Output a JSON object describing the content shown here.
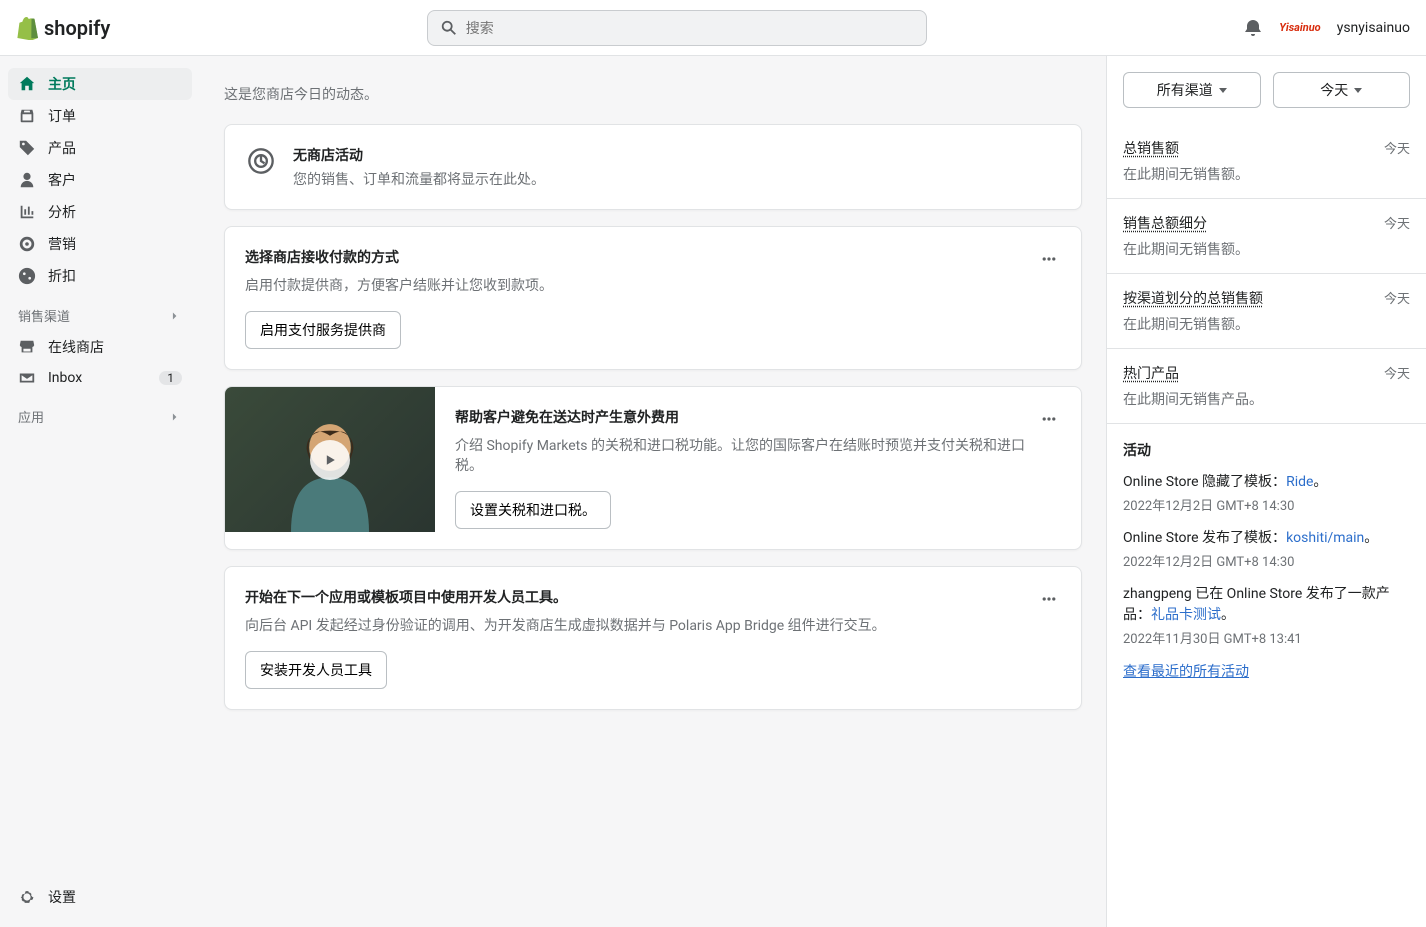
{
  "header": {
    "brand": "shopify",
    "search_placeholder": "搜索",
    "tag": "Yisainuo",
    "username": "ysnyisainuo"
  },
  "sidebar": {
    "items": [
      {
        "label": "主页",
        "icon": "home",
        "active": true
      },
      {
        "label": "订单",
        "icon": "orders"
      },
      {
        "label": "产品",
        "icon": "products"
      },
      {
        "label": "客户",
        "icon": "customers"
      },
      {
        "label": "分析",
        "icon": "analytics"
      },
      {
        "label": "营销",
        "icon": "marketing"
      },
      {
        "label": "折扣",
        "icon": "discounts"
      }
    ],
    "channels_label": "销售渠道",
    "channels": [
      {
        "label": "在线商店",
        "icon": "store"
      },
      {
        "label": "Inbox",
        "icon": "inbox",
        "badge": "1"
      }
    ],
    "apps_label": "应用",
    "settings_label": "设置"
  },
  "main": {
    "subtitle": "这是您商店今日的动态。",
    "feed": {
      "title": "无商店活动",
      "desc": "您的销售、订单和流量都将显示在此处。"
    },
    "cards": [
      {
        "title": "选择商店接收付款的方式",
        "desc": "启用付款提供商，方便客户结账并让您收到款项。",
        "button": "启用支付服务提供商"
      },
      {
        "media": true,
        "title": "帮助客户避免在送达时产生意外费用",
        "desc": "介绍 Shopify Markets 的关税和进口税功能。让您的国际客户在结账时预览并支付关税和进口税。",
        "button": "设置关税和进口税。"
      },
      {
        "title": "开始在下一个应用或模板项目中使用开发人员工具。",
        "desc": "向后台 API 发起经过身份验证的调用、为开发商店生成虚拟数据并与 Polaris App Bridge 组件进行交互。",
        "button": "安装开发人员工具"
      }
    ]
  },
  "panel": {
    "dropdown_channels": "所有渠道",
    "dropdown_today": "今天",
    "metrics": [
      {
        "label": "总销售额",
        "time": "今天",
        "empty": "在此期间无销售额。"
      },
      {
        "label": "销售总额细分",
        "time": "今天",
        "empty": "在此期间无销售额。"
      },
      {
        "label": "按渠道划分的总销售额",
        "time": "今天",
        "empty": "在此期间无销售额。"
      },
      {
        "label": "热门产品",
        "time": "今天",
        "empty": "在此期间无销售产品。"
      }
    ],
    "activity_title": "活动",
    "activities": [
      {
        "prefix": "Online Store 隐藏了模板：",
        "link": "Ride",
        "suffix": "。",
        "time": "2022年12月2日 GMT+8 14:30"
      },
      {
        "prefix": "Online Store 发布了模板：",
        "link": "koshiti/main",
        "suffix": "。",
        "time": "2022年12月2日 GMT+8 14:30"
      },
      {
        "prefix": "zhangpeng 已在 Online Store 发布了一款产品：",
        "link": "礼品卡测试",
        "suffix": "。",
        "time": "2022年11月30日 GMT+8 13:41"
      }
    ],
    "view_all": "查看最近的所有活动"
  }
}
